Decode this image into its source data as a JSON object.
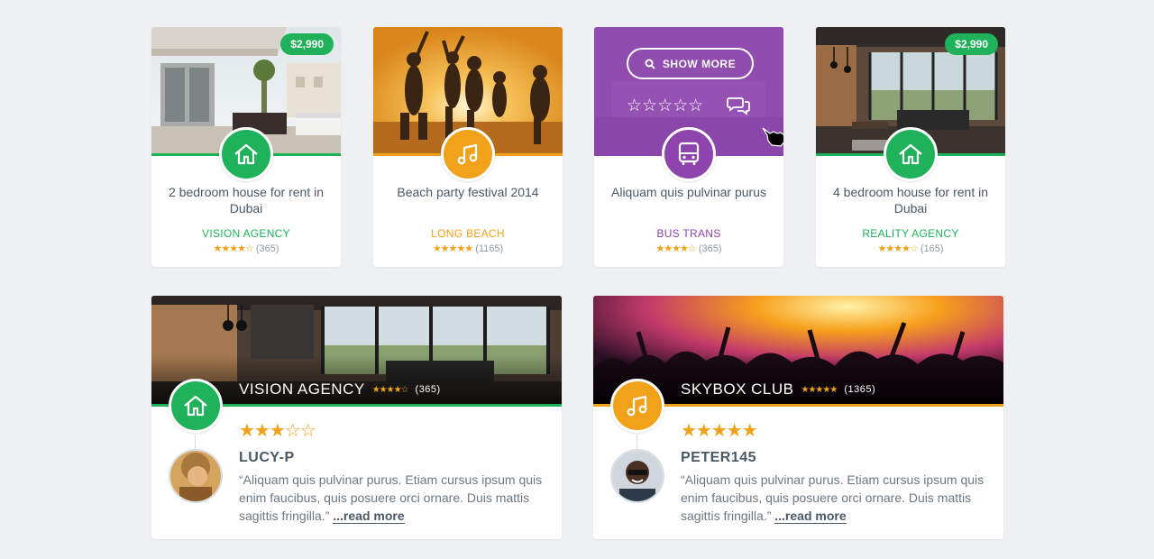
{
  "colors": {
    "green": "#1fb25a",
    "orange": "#f0a21b",
    "purple": "#8e44ad",
    "star": "#f0a21b"
  },
  "listings": [
    {
      "price": "$2,990",
      "title": "2 bedroom house for rent in Dubai",
      "agency": "VISION AGENCY",
      "review_count": "(365)",
      "stars": "★★★★☆",
      "icon": "house-icon",
      "accent": "#1fb25a"
    },
    {
      "title": "Beach party festival 2014",
      "agency": "LONG BEACH",
      "review_count": "(1165)",
      "stars": "★★★★★",
      "icon": "music-note-icon",
      "accent": "#f0a21b"
    },
    {
      "title": "Aliquam quis pulvinar purus",
      "agency": "BUS TRANS",
      "review_count": "(365)",
      "stars": "★★★★☆",
      "icon": "bus-icon",
      "accent": "#8e44ad",
      "overlay": {
        "show_more_label": "SHOW MORE",
        "stars": "☆☆☆☆☆"
      }
    },
    {
      "price": "$2,990",
      "title": "4 bedroom house for rent in Dubai",
      "agency": "REALITY AGENCY",
      "review_count": "(165)",
      "stars": "★★★★☆",
      "icon": "house-icon",
      "accent": "#1fb25a"
    }
  ],
  "reviews": [
    {
      "place_name": "VISION AGENCY",
      "place_stars": "★★★★☆",
      "place_count": "(365)",
      "icon": "house-icon",
      "accent": "#1fb25a",
      "review_stars": "★★★☆☆",
      "user": "LUCY-P",
      "quote": "“Aliquam quis pulvinar purus. Etiam cursus ipsum quis enim faucibus, quis posuere orci ornare. Duis mattis sagittis fringilla.”",
      "read_more": "...read more"
    },
    {
      "place_name": "SKYBOX CLUB",
      "place_stars": "★★★★★",
      "place_count": "(1365)",
      "icon": "music-note-icon",
      "accent": "#f0a21b",
      "review_stars": "★★★★★",
      "user": "PETER145",
      "quote": "“Aliquam quis pulvinar purus. Etiam cursus ipsum quis enim faucibus, quis posuere orci ornare. Duis mattis sagittis fringilla.”",
      "read_more": "...read more"
    }
  ]
}
